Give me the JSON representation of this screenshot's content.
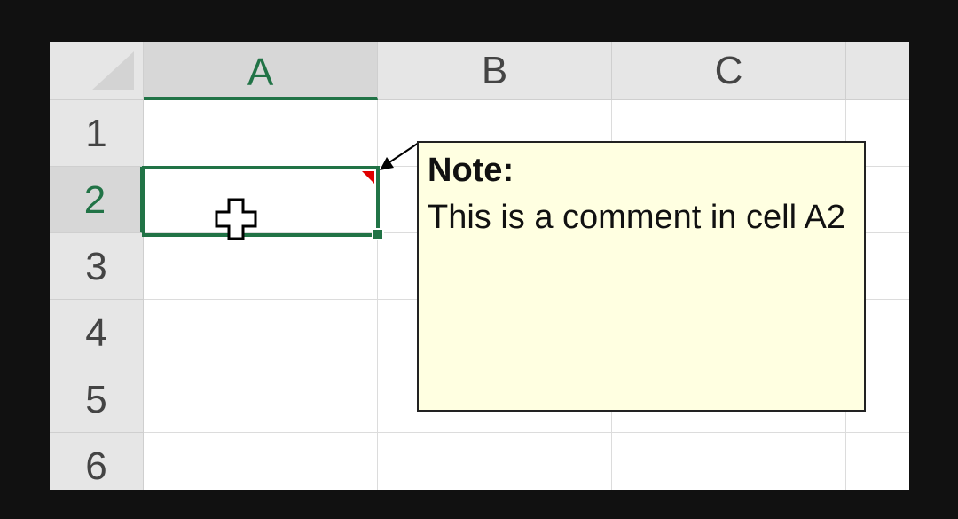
{
  "spreadsheet": {
    "columns": [
      "A",
      "B",
      "C"
    ],
    "rows": [
      "1",
      "2",
      "3",
      "4",
      "5",
      "6"
    ],
    "active_cell": "A2",
    "active_column": "A",
    "active_row": "2"
  },
  "note": {
    "title": "Note:",
    "body": "This is a comment in cell A2"
  },
  "colors": {
    "accent": "#217346",
    "note_background": "#ffffe1",
    "comment_indicator": "#e00000"
  },
  "icons": {
    "cursor": "cell-select-cross-icon",
    "comment_indicator": "comment-indicator-icon"
  }
}
